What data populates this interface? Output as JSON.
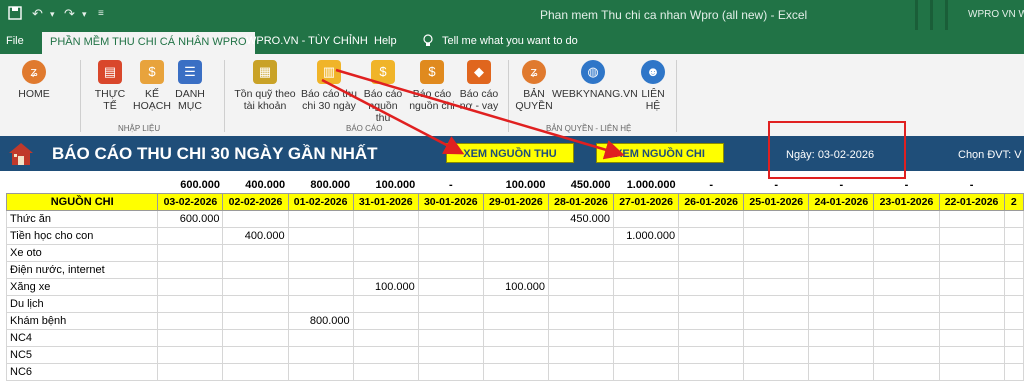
{
  "titlebar": {
    "doc_title": "Phan mem Thu chi ca nhan Wpro (all new)  -  Excel",
    "user": "WPRO VN WEB"
  },
  "tabs": [
    {
      "label": "File"
    },
    {
      "label": "PHẦN MỀM THU CHI CÁ NHÂN WPRO",
      "active": true
    },
    {
      "label": "WPRO.VN - TÙY CHỈNH"
    },
    {
      "label": "Help"
    }
  ],
  "tell_me": "Tell me what you want to do",
  "ribbon": {
    "home": "HOME",
    "nhap_lieu": {
      "btn1": [
        "THỰC",
        "TẾ"
      ],
      "btn2": [
        "KẾ",
        "HOẠCH"
      ],
      "btn3": [
        "DANH",
        "MỤC"
      ],
      "group": "NHẬP LIỆU"
    },
    "bao_cao": {
      "btn1": [
        "Tồn quỹ theo",
        "tài khoản"
      ],
      "btn2": [
        "Báo cáo thu",
        "chi 30 ngày"
      ],
      "btn3": [
        "Báo cáo",
        "nguồn thu"
      ],
      "btn4": [
        "Báo cáo",
        "nguồn chi"
      ],
      "btn5": [
        "Báo cáo",
        "nợ - vay"
      ],
      "group": "BÁO CÁO"
    },
    "ban_quyen": {
      "btn1": [
        "BẢN",
        "QUYỀN"
      ],
      "btn2": "WEBKYNANG.VN",
      "btn3": [
        "LIÊN",
        "HỆ"
      ],
      "group": "BẢN QUYỀN - LIÊN HỆ"
    }
  },
  "report": {
    "title": "BÁO CÁO THU CHI 30 NGÀY GẦN NHẤT",
    "btn_thu": "XEM NGUỒN THU",
    "btn_chi": "XEM NGUỒN CHI",
    "date_label": "Ngày:",
    "date_value": "03-02-2026",
    "dvt_label": "Chọn ĐVT:",
    "dvt_value": "V"
  },
  "table": {
    "header_label": "NGUỒN CHI",
    "dates": [
      "03-02-2026",
      "02-02-2026",
      "01-02-2026",
      "31-01-2026",
      "30-01-2026",
      "29-01-2026",
      "28-01-2026",
      "27-01-2026",
      "26-01-2026",
      "25-01-2026",
      "24-01-2026",
      "23-01-2026",
      "22-01-2026",
      "2"
    ],
    "totals": [
      "600.000",
      "400.000",
      "800.000",
      "100.000",
      "-",
      "100.000",
      "450.000",
      "1.000.000",
      "-",
      "-",
      "-",
      "-",
      "-",
      ""
    ],
    "rows": [
      {
        "label": "Thức ăn",
        "cells": [
          "600.000",
          "",
          "",
          "",
          "",
          "",
          "450.000",
          "",
          "",
          "",
          "",
          "",
          "",
          ""
        ]
      },
      {
        "label": "Tiền học cho con",
        "cells": [
          "",
          "400.000",
          "",
          "",
          "",
          "",
          "",
          "1.000.000",
          "",
          "",
          "",
          "",
          "",
          ""
        ]
      },
      {
        "label": "Xe oto",
        "cells": [
          "",
          "",
          "",
          "",
          "",
          "",
          "",
          "",
          "",
          "",
          "",
          "",
          "",
          ""
        ]
      },
      {
        "label": "Điện nước, internet",
        "cells": [
          "",
          "",
          "",
          "",
          "",
          "",
          "",
          "",
          "",
          "",
          "",
          "",
          "",
          ""
        ]
      },
      {
        "label": "Xăng xe",
        "cells": [
          "",
          "",
          "",
          "100.000",
          "",
          "100.000",
          "",
          "",
          "",
          "",
          "",
          "",
          "",
          ""
        ]
      },
      {
        "label": "Du lịch",
        "cells": [
          "",
          "",
          "",
          "",
          "",
          "",
          "",
          "",
          "",
          "",
          "",
          "",
          "",
          ""
        ]
      },
      {
        "label": "Khám bệnh",
        "cells": [
          "",
          "",
          "800.000",
          "",
          "",
          "",
          "",
          "",
          "",
          "",
          "",
          "",
          "",
          ""
        ]
      },
      {
        "label": "NC4",
        "cells": [
          "",
          "",
          "",
          "",
          "",
          "",
          "",
          "",
          "",
          "",
          "",
          "",
          "",
          ""
        ]
      },
      {
        "label": "NC5",
        "cells": [
          "",
          "",
          "",
          "",
          "",
          "",
          "",
          "",
          "",
          "",
          "",
          "",
          "",
          ""
        ]
      },
      {
        "label": "NC6",
        "cells": [
          "",
          "",
          "",
          "",
          "",
          "",
          "",
          "",
          "",
          "",
          "",
          "",
          "",
          ""
        ]
      }
    ]
  },
  "colors": {
    "excel_green": "#217346",
    "band_blue": "#1f4e79",
    "yellow": "#ffff00",
    "red_annotation": "#e02020"
  }
}
